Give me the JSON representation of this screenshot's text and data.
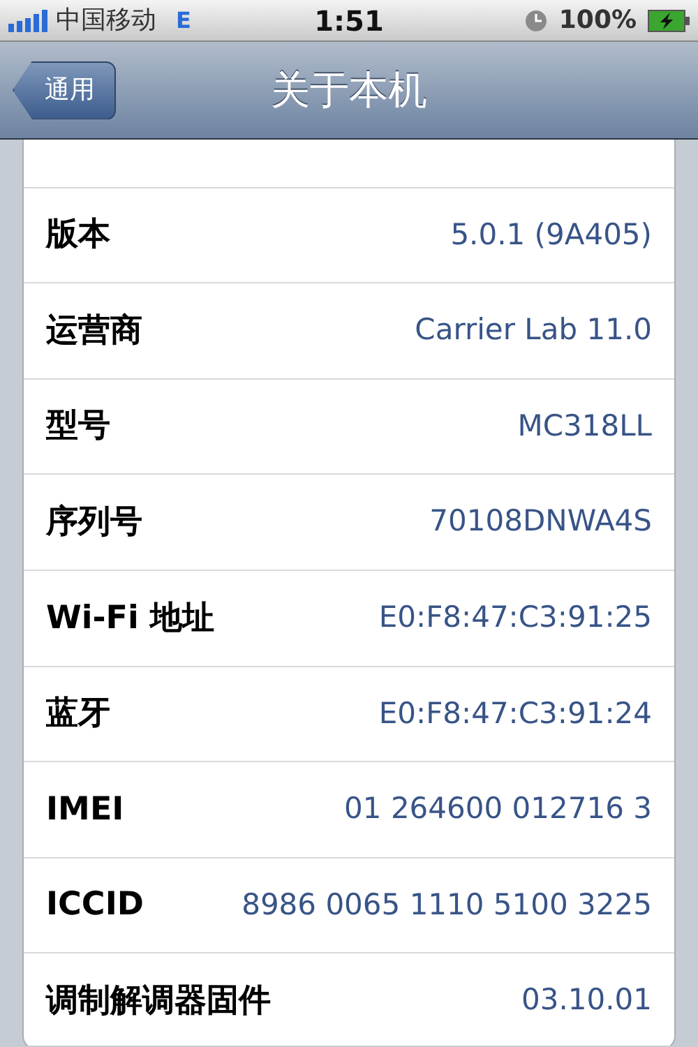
{
  "status_bar": {
    "carrier": "中国移动",
    "network": "E",
    "time": "1:51",
    "battery": "100%"
  },
  "nav_bar": {
    "back": "通用",
    "title": "关于本机"
  },
  "rows": [
    {
      "label": "版本",
      "value": "5.0.1 (9A405)"
    },
    {
      "label": "运营商",
      "value": "Carrier Lab 11.0"
    },
    {
      "label": "型号",
      "value": "MC318LL"
    },
    {
      "label": "序列号",
      "value": "70108DNWA4S"
    },
    {
      "label": "Wi-Fi 地址",
      "value": "E0:F8:47:C3:91:25"
    },
    {
      "label": "蓝牙",
      "value": "E0:F8:47:C3:91:24"
    },
    {
      "label": "IMEI",
      "value": "01 264600 012716 3"
    },
    {
      "label": "ICCID",
      "value": "8986 0065 1110 5100 3225"
    },
    {
      "label": "调制解调器固件",
      "value": "03.10.01"
    }
  ]
}
